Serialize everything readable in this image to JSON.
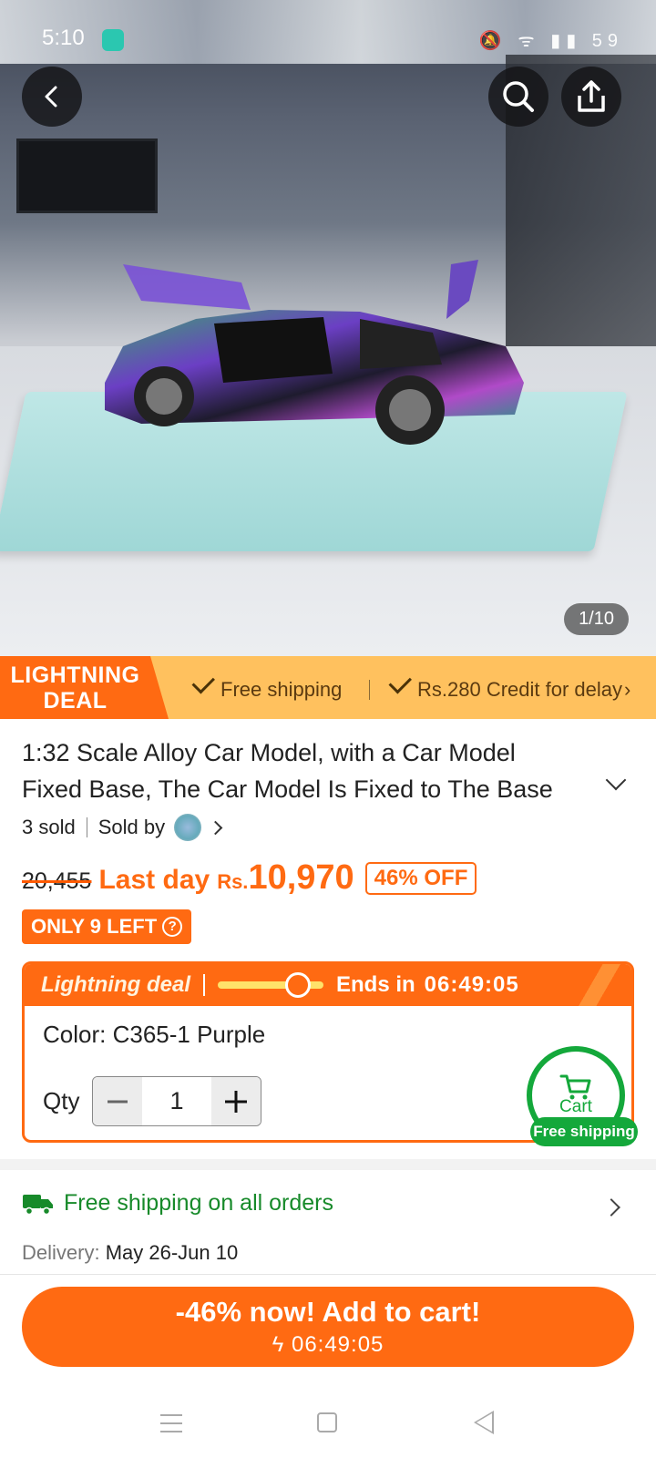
{
  "status_bar": {
    "time": "5:10",
    "icons": "🔕 ᯤ ▮▮ 59"
  },
  "gallery": {
    "counter": "1/10"
  },
  "deal_banner": {
    "tag_line1": "LIGHTNING",
    "tag_line2": "DEAL",
    "feature1": "Free shipping",
    "feature2": "Rs.280 Credit for delay"
  },
  "product": {
    "title": "1:32 Scale Alloy Car Model, with a Car Model Fixed Base, The Car Model Is Fixed to The Base",
    "sold": "3 sold",
    "sold_by": "Sold by",
    "old_price": "20,455",
    "last_day": "Last day",
    "currency": "Rs.",
    "price": "10,970",
    "discount": "46% OFF",
    "stock": "ONLY 9 LEFT"
  },
  "lightning_deal": {
    "title": "Lightning deal",
    "ends_label": "Ends in",
    "timer": "06:49:05",
    "color_line": "Color: C365-1 Purple",
    "qty_label": "Qty",
    "qty_value": "1"
  },
  "cart_button": {
    "label": "Cart",
    "pill": "Free shipping"
  },
  "shipping": {
    "title": "Free shipping on all orders",
    "delivery_label": "Delivery:",
    "delivery_value": "May 26-Jun 10"
  },
  "cta": {
    "line1": "-46% now! Add to cart!",
    "timer": "06:49:05"
  },
  "colors": {
    "accent": "#ff6a12",
    "banner": "#ffc15e",
    "green": "#14a83b"
  }
}
